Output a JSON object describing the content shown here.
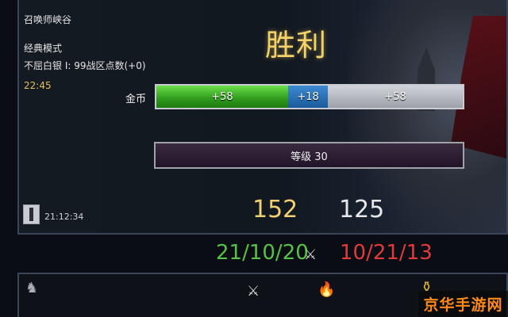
{
  "match": {
    "map": "召唤师峡谷",
    "mode": "经典模式",
    "rank": "不屈白银 I: 99战区点数(+0)",
    "duration": "22:45",
    "result": "胜利",
    "clock": "21:12:34"
  },
  "gold": {
    "label": "金币",
    "segments": [
      {
        "label": "+58",
        "color": "#3fb52a",
        "share": 0.43
      },
      {
        "label": "+18",
        "color": "#2a6fb5",
        "share": 0.13
      },
      {
        "label": "+58",
        "color": "#b4b8be",
        "share": 0.44
      }
    ]
  },
  "level": {
    "label": "等级 30"
  },
  "scores": {
    "left": "152",
    "right": "125",
    "left_color": "#f0d070",
    "right_color": "#e8e8e8"
  },
  "kda": {
    "left": "21/10/20",
    "right": "10/21/13",
    "left_color": "#58c048",
    "right_color": "#e03a3a"
  },
  "icons": [
    "crossed-swords-icon",
    "champion-icon",
    "swords-icon",
    "fire-icon",
    "gold-bag-icon"
  ],
  "watermark": "京华手游网"
}
